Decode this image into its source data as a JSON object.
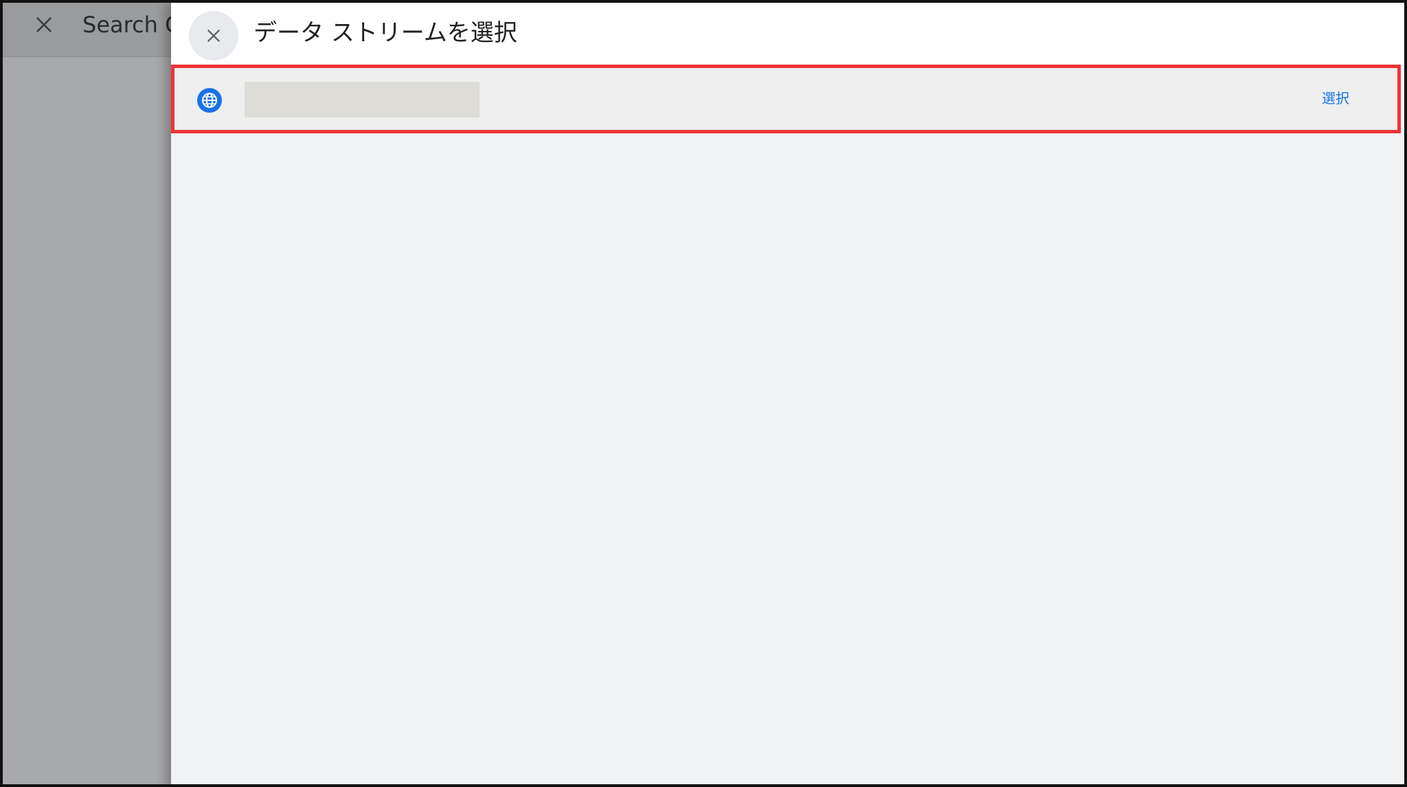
{
  "background_page": {
    "title": "Search C"
  },
  "panel": {
    "title": "データ ストリームを選択"
  },
  "stream_list": {
    "items": [
      {
        "name": "",
        "action_label": "選択"
      }
    ]
  },
  "colors": {
    "accent": "#1a73e8",
    "highlight_border": "#ee3338",
    "overlay": "#a8a9ab",
    "panel_background": "#f1f3f4"
  },
  "icons": {
    "background_close": "close-icon",
    "panel_close": "close-icon",
    "stream_type": "globe-icon"
  }
}
